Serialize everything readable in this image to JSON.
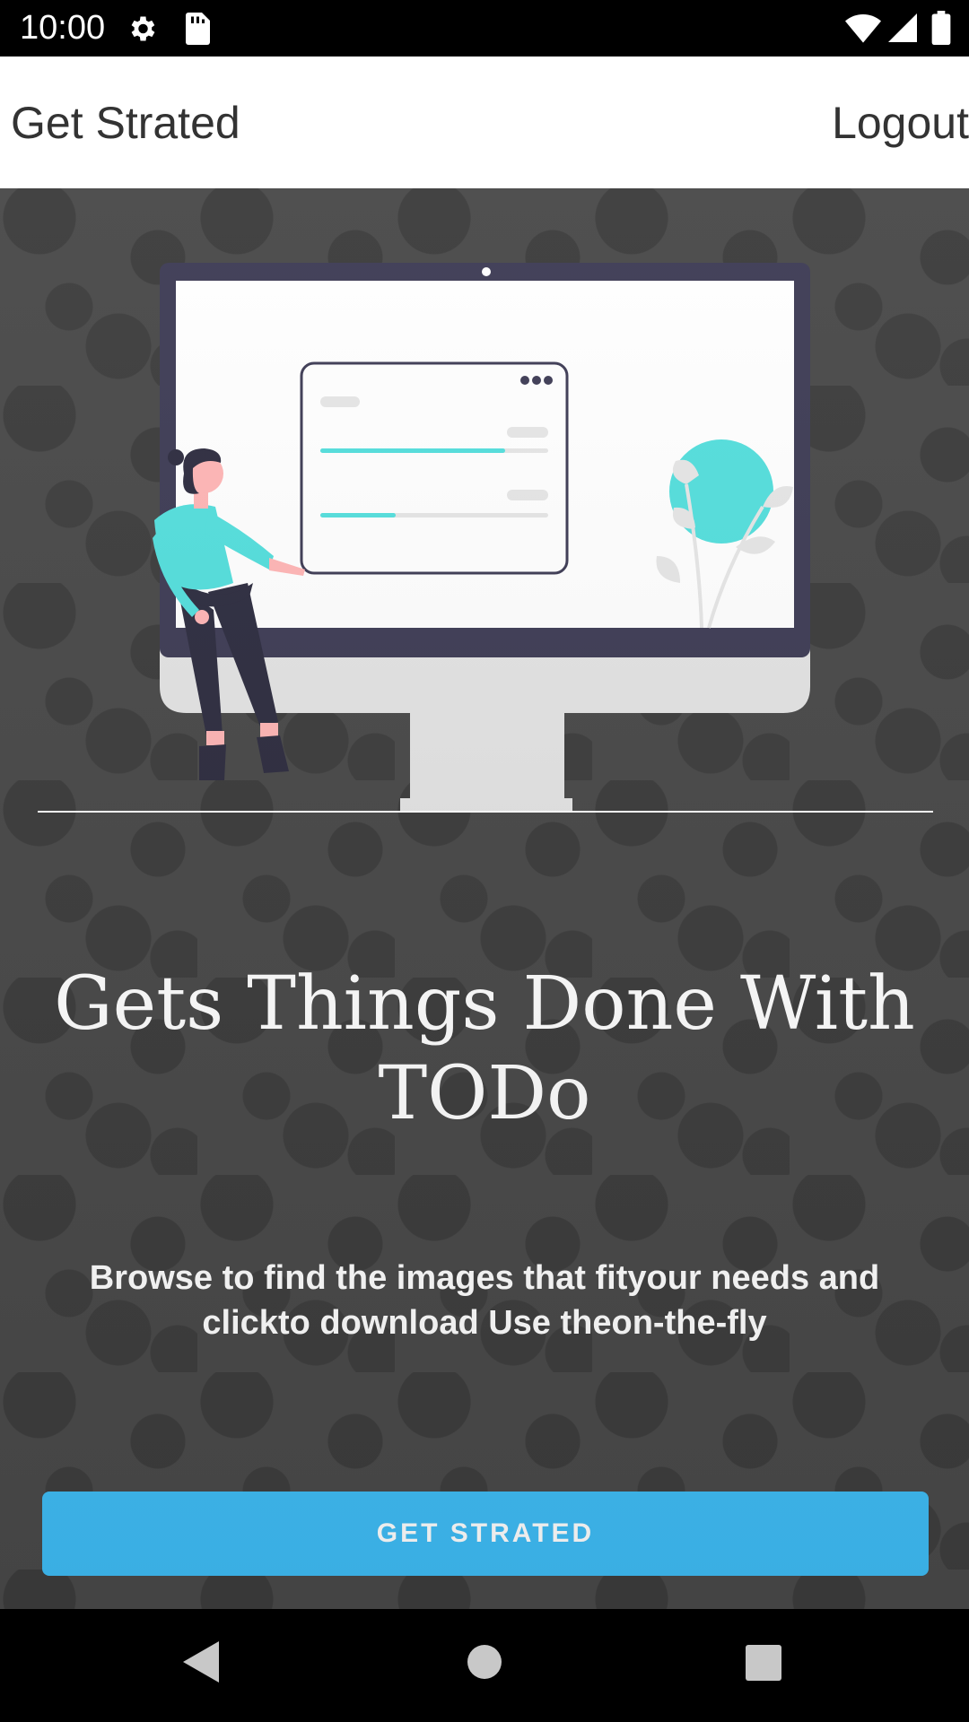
{
  "status_bar": {
    "time": "10:00",
    "icons": [
      "gear-icon",
      "sd-card-icon",
      "wifi-icon",
      "signal-icon",
      "battery-icon"
    ]
  },
  "app_bar": {
    "title": "Get Strated",
    "logout_label": "Logout"
  },
  "hero": {
    "illustration": "person-at-computer-illustration",
    "headline": "Gets Things Done With TODo",
    "description": "Browse to find the images that fityour needs and clickto download Use theon-the-fly",
    "cta_label": "GET STRATED"
  },
  "nav_bar": {
    "icons": [
      "back-icon",
      "home-icon",
      "recents-icon"
    ]
  },
  "colors": {
    "accent": "#3fbdf6",
    "illustration_teal": "#55dfdd",
    "monitor_frame": "#3f3d56",
    "background": "#4a4a4a"
  }
}
